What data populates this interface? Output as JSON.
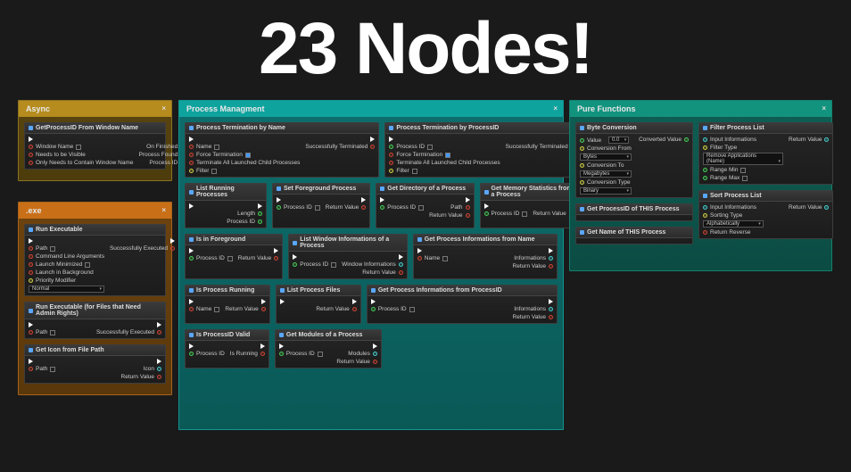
{
  "headline": "23 Nodes!",
  "panels": {
    "async": {
      "title": "Async"
    },
    "exe": {
      "title": ".exe"
    },
    "proc": {
      "title": "Process Managment"
    },
    "pure": {
      "title": "Pure Functions"
    }
  },
  "asyncNode": {
    "title": "GetProcessID From Window Name",
    "p_window": "Window Name",
    "p_visible": "Needs to be Visible",
    "p_only": "Only Needs to Contain Window Name",
    "o_finished": "On Finished",
    "o_found": "Process Found",
    "o_pid": "Process ID"
  },
  "exe": {
    "run": {
      "title": "Run Executable",
      "p_path": "Path",
      "p_args": "Command Line Arguments",
      "p_min": "Launch Minimized",
      "p_bg": "Launch in Background",
      "p_prio": "Priority Modifier",
      "p_prio_val": "Normal",
      "o_ok": "Successfully Executed"
    },
    "admin": {
      "title": "Run Executable (for Files that Need Admin Rights)",
      "p_path": "Path",
      "o_ok": "Successfully Executed"
    },
    "geticon": {
      "title": "Get Icon from File Path",
      "p_path": "Path",
      "o_icon": "Icon",
      "o_ret": "Return Value"
    }
  },
  "proc": {
    "termName": {
      "title": "Process Termination by Name",
      "p_name": "Name",
      "p_force": "Force Termination",
      "p_children": "Terminate All Launched Child Processes",
      "p_filter": "Filter",
      "o_ok": "Successfully Terminated"
    },
    "termPid": {
      "title": "Process Termination by ProcessID",
      "p_pid": "Process ID",
      "p_force": "Force Termination",
      "p_children": "Terminate All Launched Child Processes",
      "p_filter": "Filter",
      "o_ok": "Successfully Terminated"
    },
    "listRunning": {
      "title": "List Running Processes",
      "o_len": "Length",
      "o_pid": "Process ID"
    },
    "setFg": {
      "title": "Set Foreground Process",
      "p_pid": "Process ID",
      "o_ret": "Return Value"
    },
    "getDir": {
      "title": "Get Directory of a Process",
      "p_pid": "Process ID",
      "o_path": "Path",
      "o_ret": "Return Value"
    },
    "getMem": {
      "title": "Get Memory Statistics from a Process",
      "p_pid": "Process ID",
      "o_ret": "Return Value"
    },
    "isFg": {
      "title": "Is in Foreground",
      "p_pid": "Process ID",
      "o_ret": "Return Value"
    },
    "listWin": {
      "title": "List Window Informations of a Process",
      "p_pid": "Process ID",
      "o_info": "Window Informations",
      "o_ret": "Return Value"
    },
    "getInfoName": {
      "title": "Get Process Informations from Name",
      "p_name": "Name",
      "o_info": "Informations",
      "o_ret": "Return Value"
    },
    "isRunning": {
      "title": "Is Process Running",
      "p_name": "Name",
      "o_ret": "Return Value"
    },
    "listFiles": {
      "title": "List Process Files",
      "o_ret": "Return Value"
    },
    "getInfoPid": {
      "title": "Get Process Informations from ProcessID",
      "p_pid": "Process ID",
      "o_info": "Informations",
      "o_ret": "Return Value"
    },
    "isValid": {
      "title": "Is ProcessID Valid",
      "p_pid": "Process ID",
      "o_run": "Is Running"
    },
    "getMods": {
      "title": "Get Modules of a Process",
      "p_pid": "Process ID",
      "o_mods": "Modules",
      "o_ret": "Return Value"
    }
  },
  "pure": {
    "conv": {
      "title": "Byte Conversion",
      "p_val": "Value",
      "p_val_v": "0.0",
      "p_from": "Conversion From",
      "p_from_v": "Bytes",
      "p_to": "Conversion To",
      "p_to_v": "Megabytes",
      "p_type": "Conversion Type",
      "p_type_v": "Binary",
      "o_val": "Converted Value"
    },
    "filter": {
      "title": "Filter Process List",
      "p_in": "Input Informations",
      "p_type": "Filter Type",
      "p_type_v": "Remove Applications (Name)",
      "p_min": "Range Min",
      "p_max": "Range Max",
      "o_ret": "Return Value"
    },
    "sort": {
      "title": "Sort Process List",
      "p_in": "Input Informations",
      "p_type": "Sorting Type",
      "p_type_v": "Alphabetically",
      "p_rev": "Return Reverse",
      "o_ret": "Return Value"
    },
    "getPid": {
      "title": "Get ProcessID of THIS Process"
    },
    "getName": {
      "title": "Get Name of THIS Process"
    }
  }
}
